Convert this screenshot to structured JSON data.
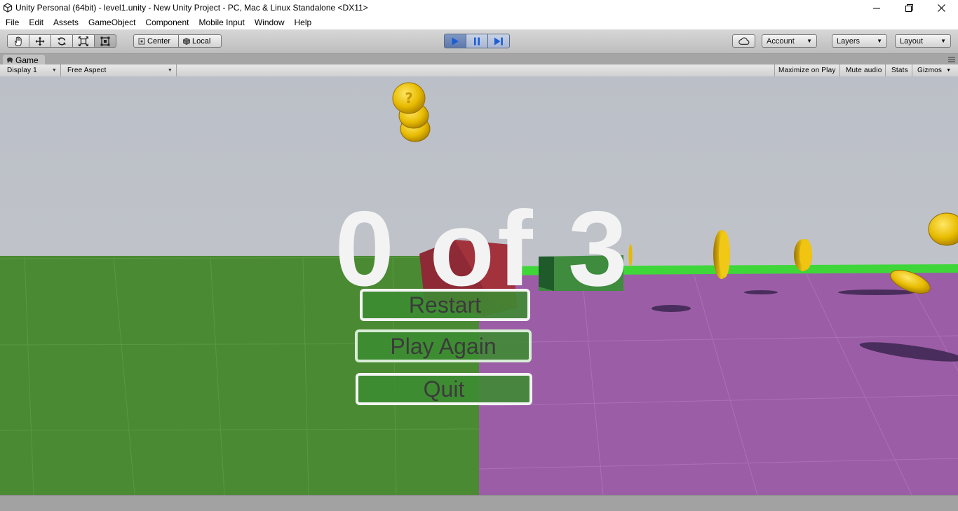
{
  "window": {
    "title": "Unity Personal (64bit) - level1.unity - New Unity Project - PC, Mac & Linux Standalone <DX11>",
    "controls": [
      "minimize-icon",
      "restore-icon",
      "close-icon"
    ]
  },
  "menu": {
    "items": [
      {
        "label": "File"
      },
      {
        "label": "Edit"
      },
      {
        "label": "Assets"
      },
      {
        "label": "GameObject"
      },
      {
        "label": "Component"
      },
      {
        "label": "Mobile Input"
      },
      {
        "label": "Window"
      },
      {
        "label": "Help"
      }
    ]
  },
  "toolbar": {
    "tools": [
      "hand-tool-icon",
      "move-tool-icon",
      "rotate-tool-icon",
      "scale-tool-icon",
      "rect-tool-icon"
    ],
    "pivot_label": "Center",
    "space_label": "Local",
    "play_controls": [
      "play-icon",
      "pause-icon",
      "step-icon"
    ],
    "cloud_icon": "cloud-icon",
    "account_label": "Account",
    "layers_label": "Layers",
    "layout_label": "Layout"
  },
  "game_panel": {
    "tab_label": "Game",
    "display_label": "Display 1",
    "aspect_label": "Free Aspect",
    "maximize_label": "Maximize on Play",
    "mute_label": "Mute audio",
    "stats_label": "Stats",
    "gizmos_label": "Gizmos"
  },
  "game": {
    "score_text": "0 of 3",
    "buttons": {
      "restart": "Restart",
      "play_again": "Play Again",
      "quit": "Quit"
    },
    "colors": {
      "sky": "#bcc0c8",
      "green_floor": "#4b8b33",
      "purple_floor": "#9a5aa6",
      "coin": "#e0b400"
    }
  }
}
